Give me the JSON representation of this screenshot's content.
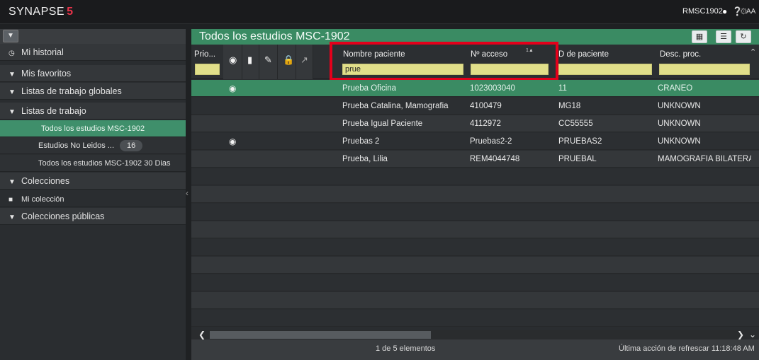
{
  "topbar": {
    "logo": "SYNAPSE",
    "logo_num": "5",
    "user": "RMSC1902",
    "aa_label": "AA",
    "icons": [
      "chat-icon",
      "help-icon",
      "settings-icon"
    ]
  },
  "sidebar": {
    "items": [
      {
        "label": "Mi historial"
      },
      {
        "label": "Mis favoritos"
      },
      {
        "label": "Listas de trabajo globales"
      },
      {
        "label": "Listas de trabajo"
      },
      {
        "label": "Todos los estudios  MSC-1902"
      },
      {
        "label": "Estudios No Leidos ...",
        "badge": "16"
      },
      {
        "label": "Todos los estudios MSC-1902 30 Dias"
      },
      {
        "label": "Colecciones"
      },
      {
        "label": "Mi colección"
      },
      {
        "label": "Colecciones públicas"
      }
    ]
  },
  "main": {
    "title": "Todos los estudios  MSC-1902",
    "columns": {
      "prio": "Prio...",
      "nombre": "Nombre paciente",
      "acceso": "Nº acceso",
      "id": "D de paciente",
      "desc": "Desc. proc."
    },
    "sort_indicator": "1▲",
    "filters": {
      "nombre": "prue"
    },
    "rows": [
      {
        "camera": true,
        "nombre": "Prueba Oficina",
        "acceso": "1023003040",
        "id": "11",
        "desc": "CRANEO"
      },
      {
        "camera": false,
        "nombre": "Prueba Catalina, Mamografia",
        "acceso": "4100479",
        "id": "MG18",
        "desc": "UNKNOWN"
      },
      {
        "camera": false,
        "nombre": "Prueba Igual Paciente",
        "acceso": "4112972",
        "id": "CC55555",
        "desc": "UNKNOWN"
      },
      {
        "camera": true,
        "nombre": "Pruebas 2",
        "acceso": "Pruebas2-2",
        "id": "PRUEBAS2",
        "desc": "UNKNOWN"
      },
      {
        "camera": false,
        "nombre": "Prueba, Lilia",
        "acceso": "REM4044748",
        "id": "PRUEBAL",
        "desc": "MAMOGRAFIA BILATERAL"
      }
    ],
    "footer": {
      "count": "1 de 5 elementos",
      "refresh": "Última acción de refrescar 11:18:48 AM"
    }
  },
  "colors": {
    "accent_green": "#3a8b63",
    "filter_yellow": "#e1df8a",
    "highlight_red": "#e3001b"
  }
}
